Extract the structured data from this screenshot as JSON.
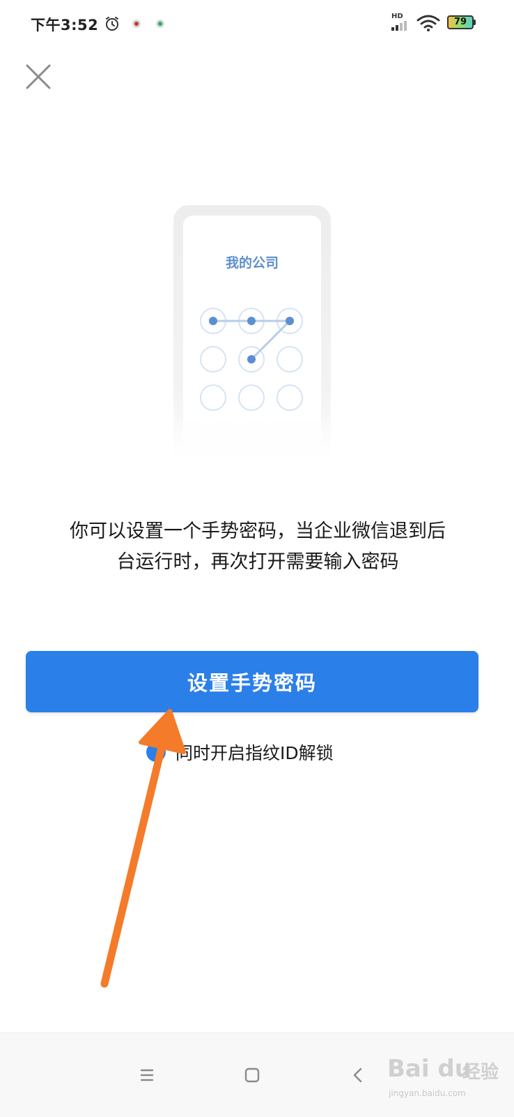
{
  "status_bar": {
    "time": "下午3:52",
    "network": "HD",
    "battery_level": "79"
  },
  "illustration": {
    "company_name": "我的公司"
  },
  "description": {
    "line1": "你可以设置一个手势密码，当企业微信退到后",
    "line2": "台运行时，再次打开需要输入密码"
  },
  "primary_button": {
    "label": "设置手势密码"
  },
  "fingerprint_option": {
    "label": "同时开启指纹ID解锁"
  },
  "watermark": {
    "brand": "Bai du",
    "cn": "经验",
    "url": "jingyan.baidu.com"
  },
  "colors": {
    "accent": "#2b7fe9",
    "pattern": "#5b8fce",
    "arrow": "#f47b2a"
  }
}
